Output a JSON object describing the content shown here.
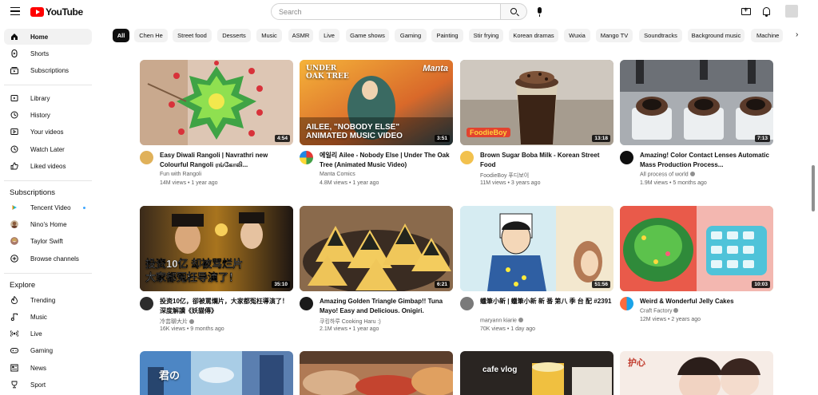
{
  "header": {
    "logo_text": "YouTube",
    "search_placeholder": "Search"
  },
  "sidebar": {
    "main": [
      {
        "label": "Home",
        "icon": "home-icon"
      },
      {
        "label": "Shorts",
        "icon": "shorts-icon"
      },
      {
        "label": "Subscriptions",
        "icon": "subscriptions-icon"
      }
    ],
    "you": [
      {
        "label": "Library",
        "icon": "library-icon"
      },
      {
        "label": "History",
        "icon": "history-icon"
      },
      {
        "label": "Your videos",
        "icon": "your-videos-icon"
      },
      {
        "label": "Watch Later",
        "icon": "watch-later-icon"
      },
      {
        "label": "Liked videos",
        "icon": "liked-icon"
      }
    ],
    "subscriptions_title": "Subscriptions",
    "subscriptions": [
      {
        "label": "Tencent Video",
        "new_content": true
      },
      {
        "label": "Nino's Home"
      },
      {
        "label": "Taylor Swift"
      },
      {
        "label": "Browse channels"
      }
    ],
    "explore_title": "Explore",
    "explore": [
      {
        "label": "Trending",
        "icon": "trending-icon"
      },
      {
        "label": "Music",
        "icon": "music-icon"
      },
      {
        "label": "Live",
        "icon": "live-icon"
      },
      {
        "label": "Gaming",
        "icon": "gaming-icon"
      },
      {
        "label": "News",
        "icon": "news-icon"
      },
      {
        "label": "Sport",
        "icon": "sport-icon"
      }
    ]
  },
  "chips": [
    "All",
    "Chen He",
    "Street food",
    "Desserts",
    "Music",
    "ASMR",
    "Live",
    "Game shows",
    "Gaming",
    "Painting",
    "Stir frying",
    "Korean dramas",
    "Wuxia",
    "Mango TV",
    "Soundtracks",
    "Background music",
    "Machine"
  ],
  "videos": [
    {
      "title": "Easy Diwali Rangoli | Navrathri new Colourful Rangoli ரங்கோலி...",
      "channel": "Fun with Rangoli",
      "verified": false,
      "views": "14M views",
      "age": "1 year ago",
      "duration": "4:54"
    },
    {
      "title": "에일리 Ailee - Nobody Else | Under The Oak Tree (Animated Music Video)",
      "channel": "Manta Comics",
      "verified": false,
      "views": "4.8M views",
      "age": "1 year ago",
      "duration": "3:51",
      "thumb_caption": "AILEE, \"NOBODY ELSE\"\nANIMATED MUSIC VIDEO",
      "thumb_brand": "Manta"
    },
    {
      "title": "Brown Sugar Boba Milk - Korean Street Food",
      "channel": "FoodieBoy 푸디보이",
      "verified": false,
      "views": "11M views",
      "age": "3 years ago",
      "duration": "13:18",
      "thumb_brand": "FoodieBoy"
    },
    {
      "title": "Amazing! Color Contact Lenses Automatic Mass Production Process...",
      "channel": "All process of world",
      "verified": true,
      "views": "1.9M views",
      "age": "5 months ago",
      "duration": "7:13"
    },
    {
      "title": "投资10亿，卻被罵爛片，大家都冤枉導演了！深度解讀《妖貓傳》",
      "channel": "冷芸聊大片",
      "verified": true,
      "views": "16K views",
      "age": "9 months ago",
      "duration": "35:10",
      "thumb_caption": "投资10亿 却被骂烂片\n大家都冤枉导演了！"
    },
    {
      "title": "Amazing Golden Triangle Gimbap!! Tuna Mayo! Easy and Delicious. Onigiri.",
      "channel": "쿠킹하루 Cooking Haru :)",
      "verified": false,
      "views": "2.1M views",
      "age": "1 year ago",
      "duration": "6:21"
    },
    {
      "title": "蠟筆小新 | 蠟筆小新 新 番 第八 季 台 配 #2391",
      "channel": "maryann kiarie",
      "verified": true,
      "views": "70K views",
      "age": "1 day ago",
      "duration": "51:56"
    },
    {
      "title": "Weird & Wonderful Jelly Cakes",
      "channel": "Craft Factory",
      "verified": true,
      "views": "12M views",
      "age": "2 years ago",
      "duration": "10:03"
    }
  ],
  "third_row_captions": [
    "cafe vlog"
  ],
  "colors": {
    "brand_red": "#ff0000",
    "chip_bg": "#f2f2f2",
    "active_chip": "#0f0f0f",
    "meta_text": "#606060"
  }
}
